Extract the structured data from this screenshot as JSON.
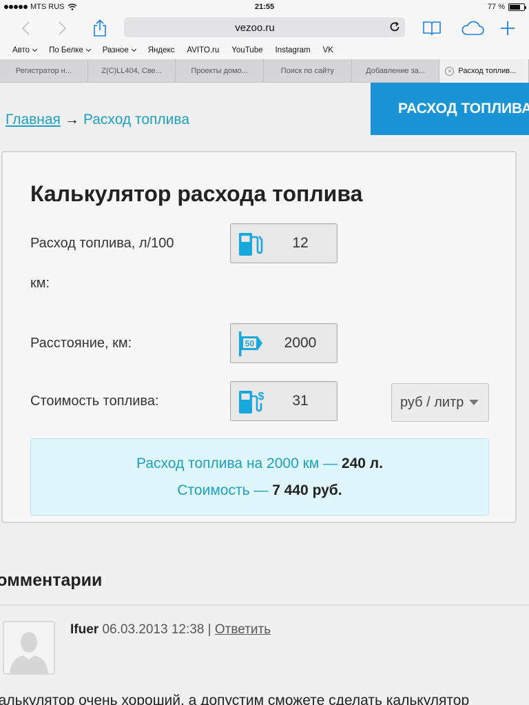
{
  "status_bar": {
    "carrier": "MTS RUS",
    "time": "21:55",
    "battery": "77 %",
    "battery_level": 0.77
  },
  "toolbar": {
    "url": "vezoo.ru"
  },
  "bookmarks": [
    {
      "label": "Авто",
      "dropdown": true
    },
    {
      "label": "По Белке",
      "dropdown": true
    },
    {
      "label": "Разное",
      "dropdown": true
    },
    {
      "label": "Яндекс",
      "dropdown": false
    },
    {
      "label": "AVITO.ru",
      "dropdown": false
    },
    {
      "label": "YouTube",
      "dropdown": false
    },
    {
      "label": "Instagram",
      "dropdown": false
    },
    {
      "label": "VK",
      "dropdown": false
    }
  ],
  "tabs": [
    {
      "label": "Регистратор н..."
    },
    {
      "label": "Z(C)LL404, Све..."
    },
    {
      "label": "Проекты домо..."
    },
    {
      "label": "Поиск по сайту"
    },
    {
      "label": "Добавление за..."
    },
    {
      "label": "Расход топлив..."
    }
  ],
  "page": {
    "banner": "РАСХОД ТОПЛИВА",
    "breadcrumb": {
      "home": "Главная",
      "arrow": "→",
      "current": "Расход топлива"
    },
    "calculator": {
      "title": "Калькулятор расхода топлива",
      "consumption": {
        "label_line1": "Расход топлива, л/100",
        "label_line2": "км:",
        "value": "12"
      },
      "distance": {
        "label": "Расстояние, км:",
        "value": "2000",
        "sign_number": "50"
      },
      "cost": {
        "label": "Стоимость топлива:",
        "value": "31"
      },
      "unit_select": {
        "value": "руб / литр"
      },
      "result": {
        "line1_prefix": "Расход топлива на 2000 км —",
        "line1_value": "240 л.",
        "line2_prefix": "Стоимость —",
        "line2_value": "7 440 руб."
      }
    },
    "comments": {
      "title": "Комментарии",
      "items": [
        {
          "author": "Ifuer",
          "date": "06.03.2013 12:38",
          "separator": "|",
          "reply": "Ответить",
          "text": "калькулятор очень хороший, а допустим сможете сделать калькулятор"
        }
      ]
    }
  },
  "colors": {
    "accent": "#1a94d4",
    "link": "#1e9fbd",
    "ios_blue": "#1a7fe0",
    "result_bg": "#dff6fd"
  }
}
